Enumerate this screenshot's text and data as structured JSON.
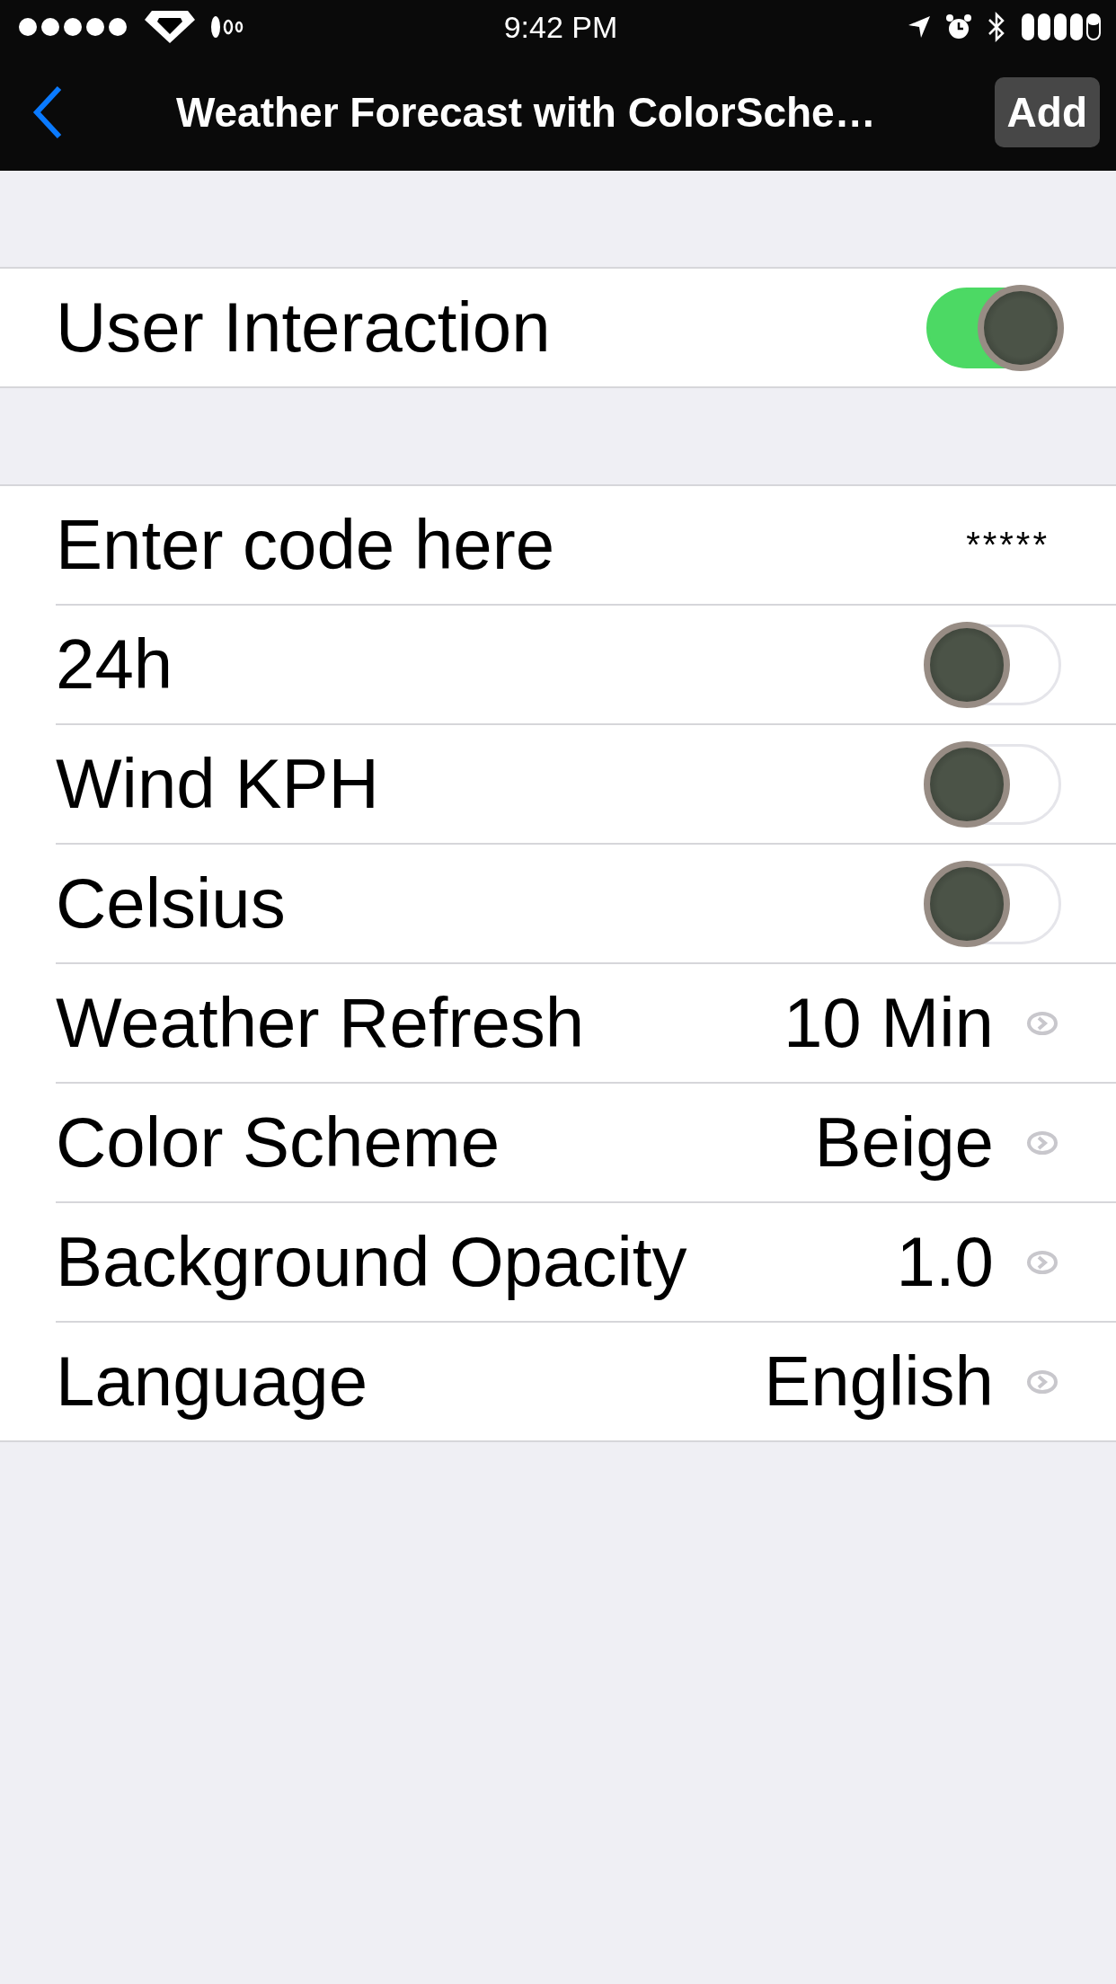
{
  "status_bar": {
    "time": "9:42 PM"
  },
  "nav_bar": {
    "title": "Weather Forecast with ColorSche…",
    "action": "Add"
  },
  "sections": [
    {
      "rows": [
        {
          "kind": "switch",
          "label": "User Interaction",
          "on": true
        }
      ]
    },
    {
      "rows": [
        {
          "kind": "field",
          "label": "Enter code here",
          "value": "*****"
        },
        {
          "kind": "switch",
          "label": "24h",
          "on": false
        },
        {
          "kind": "switch",
          "label": "Wind KPH",
          "on": false
        },
        {
          "kind": "switch",
          "label": "Celsius",
          "on": false
        },
        {
          "kind": "disclosure",
          "label": "Weather Refresh",
          "value": "10 Min"
        },
        {
          "kind": "disclosure",
          "label": "Color Scheme",
          "value": "Beige"
        },
        {
          "kind": "disclosure",
          "label": "Background Opacity",
          "value": "1.0"
        },
        {
          "kind": "disclosure",
          "label": "Language",
          "value": "English"
        }
      ]
    }
  ]
}
